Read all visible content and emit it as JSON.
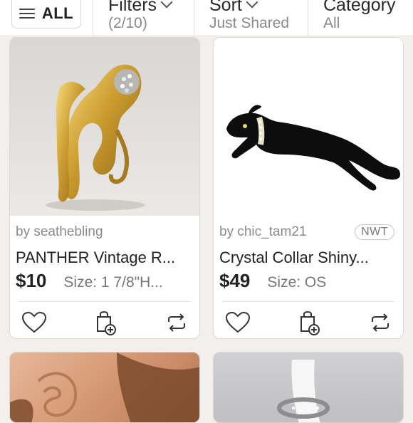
{
  "toolbar": {
    "all_label": "ALL",
    "filters": {
      "title": "Filters",
      "value": "(2/10)"
    },
    "sort": {
      "title": "Sort",
      "value": "Just Shared"
    },
    "category": {
      "title": "Category",
      "value": "All"
    }
  },
  "listings": [
    {
      "seller": "by seathebling",
      "badge": "",
      "title": "PANTHER Vintage R...",
      "price": "$10",
      "size": "Size: 1 7/8\"H...",
      "image": "gold-panther-brooch"
    },
    {
      "seller": "by chic_tam21",
      "badge": "NWT",
      "title": "Crystal Collar Shiny...",
      "price": "$49",
      "size": "Size: OS",
      "image": "black-enamel-panther-brooch"
    },
    {
      "image": "ear-with-earring"
    },
    {
      "image": "silver-ring"
    }
  ],
  "icons": {
    "like": "heart-icon",
    "bundle": "shopping-bag-add-icon",
    "share": "share-arrows-icon",
    "menu": "hamburger-menu-icon"
  },
  "colors": {
    "background": "#f2efec",
    "card": "#ffffff",
    "price": "#222222",
    "muted_text": "#8a8a8a"
  }
}
